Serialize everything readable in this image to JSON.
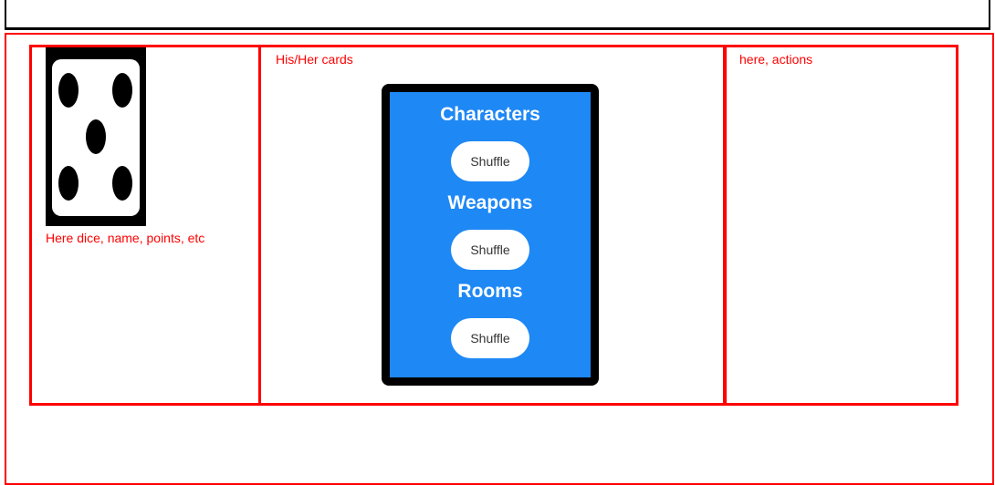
{
  "left_panel": {
    "dice_face": 5,
    "caption": "Here dice, name, points, etc"
  },
  "middle_panel": {
    "caption": "His/Her cards",
    "deck": [
      {
        "title": "Characters",
        "button_label": "Shuffle"
      },
      {
        "title": "Weapons",
        "button_label": "Shuffle"
      },
      {
        "title": "Rooms",
        "button_label": "Shuffle"
      }
    ]
  },
  "right_panel": {
    "caption": "here, actions"
  },
  "colors": {
    "panel_border": "#ff0000",
    "deck_background": "#1e88f5",
    "deck_border": "#000000"
  },
  "icons": {
    "dice": "dice-five-icon"
  }
}
